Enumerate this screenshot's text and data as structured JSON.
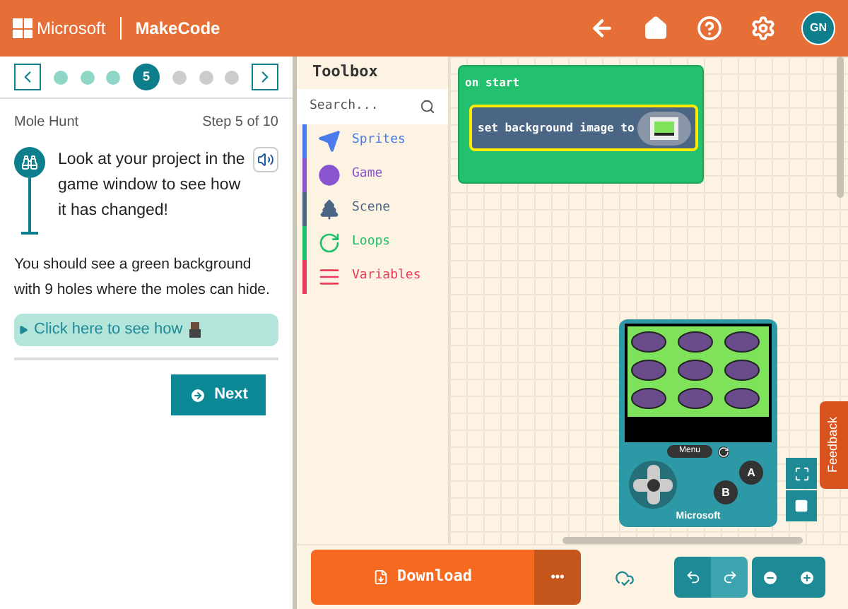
{
  "header": {
    "brand": "Microsoft",
    "product": "MakeCode",
    "avatar": "GN"
  },
  "tutorial": {
    "steps": [
      {
        "kind": "done"
      },
      {
        "kind": "done"
      },
      {
        "kind": "done"
      },
      {
        "kind": "current",
        "label": "5"
      },
      {
        "kind": "todo"
      },
      {
        "kind": "todo"
      },
      {
        "kind": "todo"
      }
    ],
    "title": "Mole Hunt",
    "progress": "Step 5 of 10",
    "callout": "Look at your project in the game window to see how it has changed!",
    "body": "You should see a green background with 9 holes where the moles can hide.",
    "hint": "Click here to see how",
    "hint_expanded": false,
    "next": "Next"
  },
  "toolbox": {
    "title": "Toolbox",
    "search_placeholder": "Search...",
    "categories": [
      {
        "label": "Sprites",
        "color": "#4b7bec",
        "kind": "plane"
      },
      {
        "label": "Game",
        "color": "#8854d0",
        "kind": "circle"
      },
      {
        "label": "Scene",
        "color": "#4b6584",
        "kind": "tree"
      },
      {
        "label": "Loops",
        "color": "#20bf6b",
        "kind": "loop"
      },
      {
        "label": "Variables",
        "color": "#eb3b5a",
        "kind": "lines"
      }
    ]
  },
  "blocks": {
    "event": "on start",
    "statement": "set background image to"
  },
  "simulator": {
    "menu": "Menu",
    "a": "A",
    "b": "B",
    "brand": "Microsoft"
  },
  "feedback": "Feedback",
  "footer": {
    "download": "Download",
    "more": "•••",
    "undo_disabled": false,
    "redo_disabled": true
  }
}
